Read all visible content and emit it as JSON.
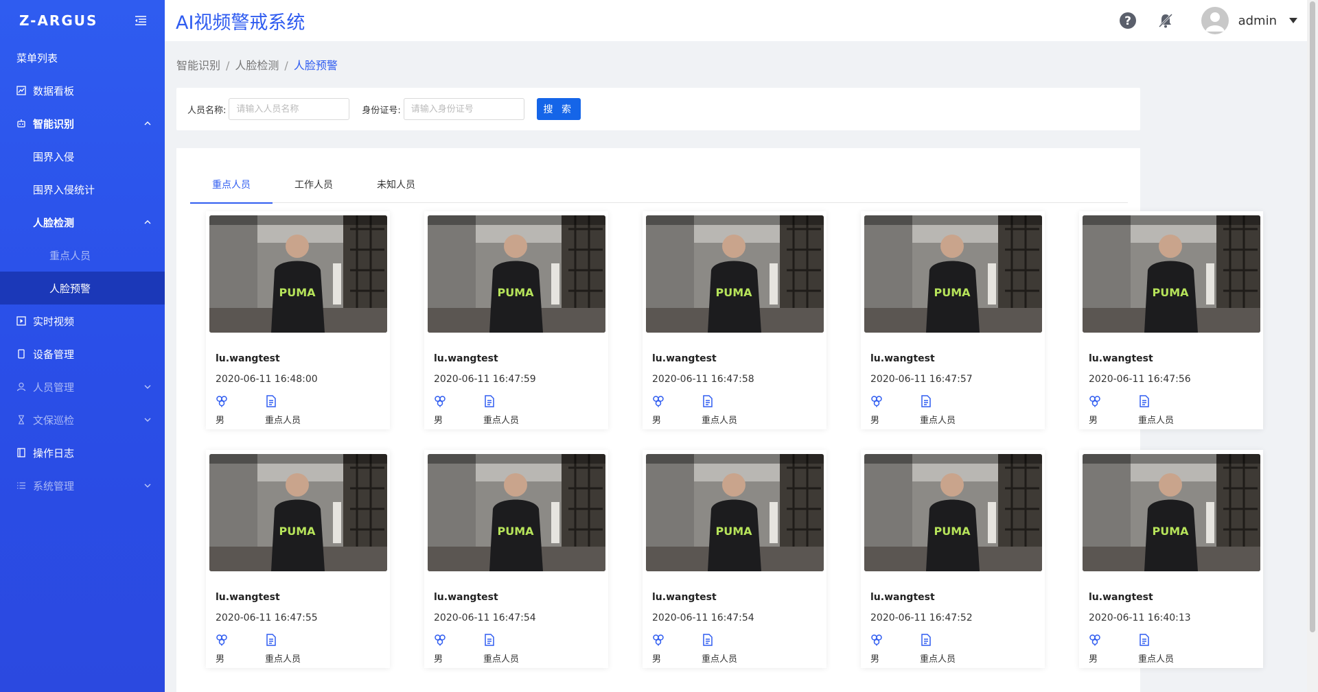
{
  "sidebar": {
    "logo": "Z-ARGUS",
    "menu_title": "菜单列表",
    "items": [
      {
        "label": "数据看板"
      },
      {
        "label": "智能识别"
      },
      {
        "label": "围界入侵"
      },
      {
        "label": "围界入侵统计"
      },
      {
        "label": "人脸检测"
      },
      {
        "label": "重点人员"
      },
      {
        "label": "人脸预警"
      },
      {
        "label": "实时视频"
      },
      {
        "label": "设备管理"
      },
      {
        "label": "人员管理"
      },
      {
        "label": "文保巡检"
      },
      {
        "label": "操作日志"
      },
      {
        "label": "系统管理"
      }
    ]
  },
  "header": {
    "title": "AI视频警戒系统",
    "user": "admin"
  },
  "breadcrumb": [
    "智能识别",
    "人脸检测",
    "人脸预警"
  ],
  "search": {
    "name_label": "人员名称:",
    "name_placeholder": "请输入人员名称",
    "id_label": "身份证号:",
    "id_placeholder": "请输入身份证号",
    "button": "搜 索"
  },
  "tabs": [
    "重点人员",
    "工作人员",
    "未知人员"
  ],
  "cards": [
    {
      "name": "lu.wangtest",
      "time": "2020-06-11 16:48:00",
      "gender": "男",
      "type": "重点人员"
    },
    {
      "name": "lu.wangtest",
      "time": "2020-06-11 16:47:59",
      "gender": "男",
      "type": "重点人员"
    },
    {
      "name": "lu.wangtest",
      "time": "2020-06-11 16:47:58",
      "gender": "男",
      "type": "重点人员"
    },
    {
      "name": "lu.wangtest",
      "time": "2020-06-11 16:47:57",
      "gender": "男",
      "type": "重点人员"
    },
    {
      "name": "lu.wangtest",
      "time": "2020-06-11 16:47:56",
      "gender": "男",
      "type": "重点人员"
    },
    {
      "name": "lu.wangtest",
      "time": "2020-06-11 16:47:55",
      "gender": "男",
      "type": "重点人员"
    },
    {
      "name": "lu.wangtest",
      "time": "2020-06-11 16:47:54",
      "gender": "男",
      "type": "重点人员"
    },
    {
      "name": "lu.wangtest",
      "time": "2020-06-11 16:47:54",
      "gender": "男",
      "type": "重点人员"
    },
    {
      "name": "lu.wangtest",
      "time": "2020-06-11 16:47:52",
      "gender": "男",
      "type": "重点人员"
    },
    {
      "name": "lu.wangtest",
      "time": "2020-06-11 16:40:13",
      "gender": "男",
      "type": "重点人员"
    }
  ],
  "colors": {
    "accent": "#2f5cf0",
    "sidebar_active": "#1b38b8",
    "button": "#1565e8"
  }
}
